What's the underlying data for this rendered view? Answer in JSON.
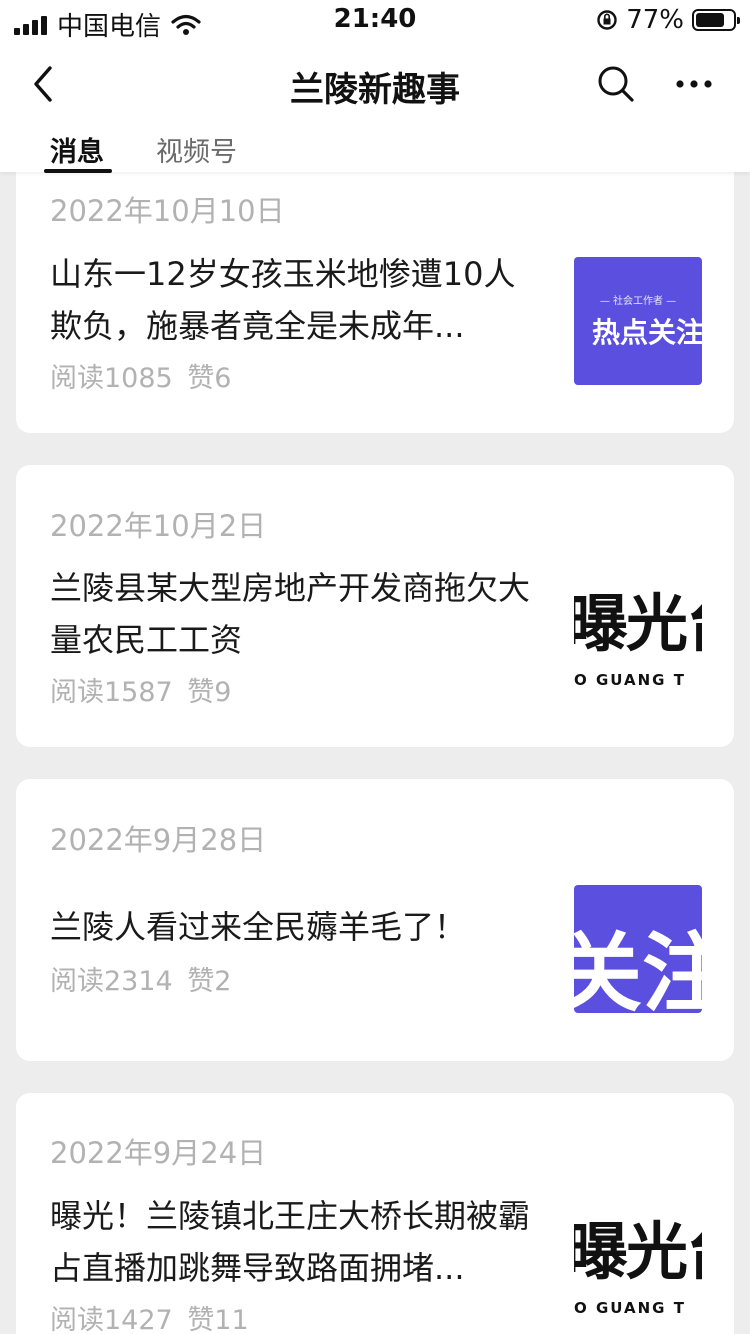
{
  "status_bar": {
    "carrier": "中国电信",
    "time": "21:40",
    "battery_percent": "77%",
    "battery_level": 0.77,
    "icons": [
      "signal-icon",
      "wifi-icon",
      "rotation-lock-icon",
      "battery-icon"
    ]
  },
  "nav": {
    "title": "兰陵新趣事",
    "back_icon": "chevron-left-icon",
    "search_icon": "search-icon",
    "more_icon": "more-horizontal-icon"
  },
  "tabs": [
    {
      "label": "消息",
      "active": true
    },
    {
      "label": "视频号",
      "active": false
    }
  ],
  "articles": [
    {
      "date": "2022年10月10日",
      "title": "山东一12岁女孩玉米地惨遭10人欺负，施暴者竟全是未成年...",
      "reads": "阅读1085",
      "likes": "赞6",
      "thumb": {
        "small_text": "— 社会工作者 —",
        "text": "热点关注"
      }
    },
    {
      "date": "2022年10月2日",
      "title": "兰陵县某大型房地产开发商拖欠大量农民工工资",
      "reads": "阅读1587",
      "likes": "赞9",
      "thumb": {
        "text": "曝光台",
        "sub": "O GUANG T"
      }
    },
    {
      "date": "2022年9月28日",
      "title": "兰陵人看过来全民薅羊毛了！",
      "reads": "阅读2314",
      "likes": "赞2",
      "thumb": {
        "text": "关注"
      }
    },
    {
      "date": "2022年9月24日",
      "title": "曝光！兰陵镇北王庄大桥长期被霸占直播加跳舞导致路面拥堵...",
      "reads": "阅读1427",
      "likes": "赞11",
      "thumb": {
        "text": "曝光台",
        "sub": "O GUANG T"
      }
    }
  ]
}
